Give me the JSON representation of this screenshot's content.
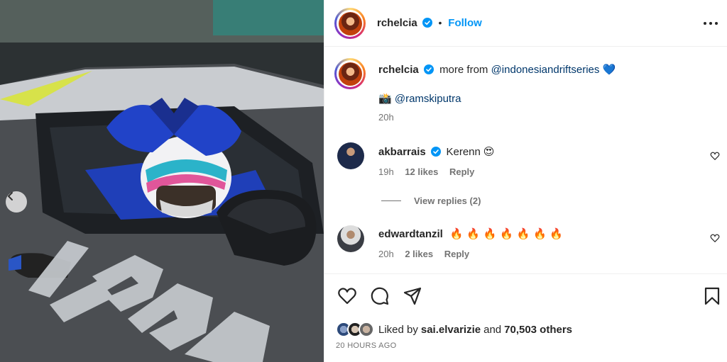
{
  "post": {
    "author": "rchelcia",
    "follow_label": "Follow",
    "separator": "•"
  },
  "caption": {
    "author": "rchelcia",
    "text": "more from",
    "mention": "@indonesiandriftseries",
    "heart": "💙",
    "camera": "📸",
    "credit": "@ramskiputra",
    "time": "20h"
  },
  "comments": [
    {
      "user": "akbarrais",
      "text": "Kerenn",
      "emoji": "😍",
      "time": "19h",
      "likes": "12 likes",
      "reply_label": "Reply",
      "view_replies": "View replies (2)"
    },
    {
      "user": "edwardtanzil",
      "text": "🔥 🔥 🔥 🔥 🔥 🔥 🔥",
      "time": "20h",
      "likes": "2 likes",
      "reply_label": "Reply"
    }
  ],
  "likes": {
    "prefix": "Liked by",
    "user": "sai.elvarizie",
    "middle": "and",
    "count": "70,503 others"
  },
  "date": "20 HOURS AGO",
  "colors": {
    "accent": "#0095f6",
    "link": "#00376b",
    "muted": "#737373",
    "glove": "#1f3fb8"
  },
  "icons": [
    "verified-badge-icon",
    "more-options-icon",
    "heart-icon",
    "comment-icon",
    "share-icon",
    "bookmark-icon",
    "carousel-left-icon"
  ]
}
